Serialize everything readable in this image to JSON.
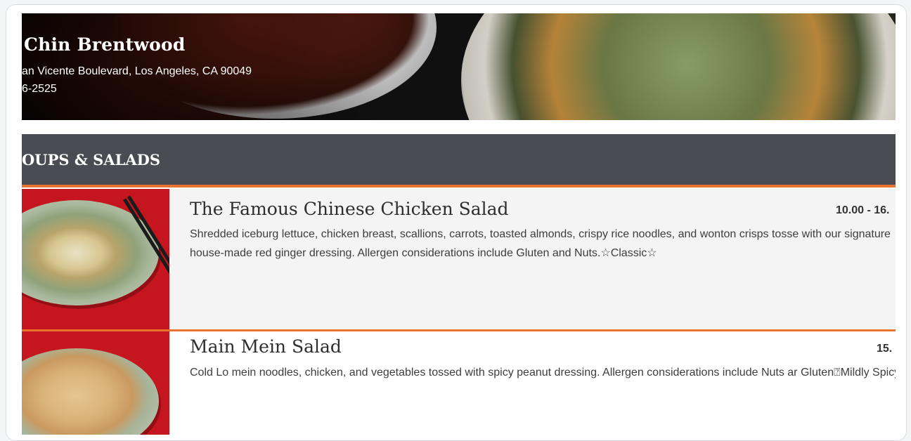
{
  "restaurant": {
    "name": "Chin Brentwood",
    "address": "an Vicente Boulevard, Los Angeles, CA 90049",
    "phone": "6-2525"
  },
  "section": {
    "title": "OUPS & SALADS"
  },
  "items": [
    {
      "name": "The Famous Chinese Chicken Salad",
      "price": "10.00 - 16.",
      "description": "Shredded iceburg lettuce, chicken breast, scallions, carrots, toasted almonds, crispy rice noodles, and wonton crisps tosse with our signature house-made red ginger dressing. Allergen considerations include Gluten and Nuts.☆Classic☆"
    },
    {
      "name": "Main Mein Salad",
      "price": "15.",
      "description": "Cold Lo mein noodles, chicken, and vegetables tossed with spicy peanut dressing. Allergen considerations include Nuts ar Gluten⍰Mildly Spicy⍰"
    }
  ],
  "colors": {
    "accent": "#e8742f",
    "section_bar": "#4a4b53",
    "item_image_bg": "#c5151e"
  }
}
